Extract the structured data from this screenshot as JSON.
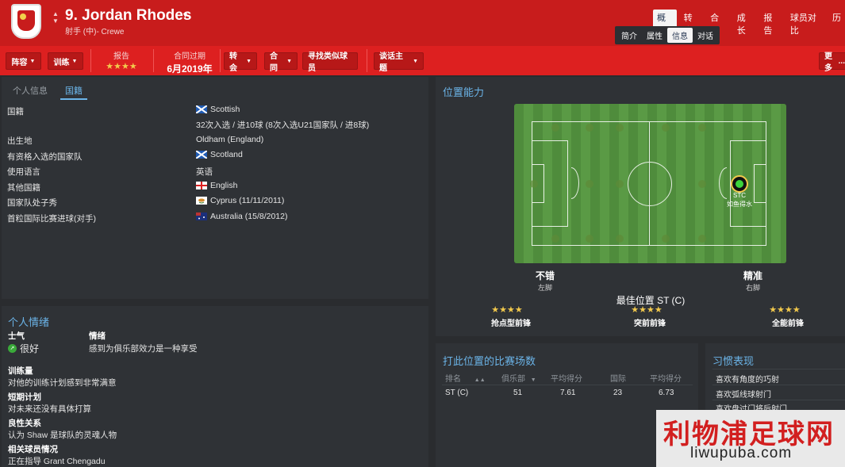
{
  "header": {
    "player_name": "9. Jordan Rhodes",
    "player_sub": "射手 (中)- Crewe",
    "nav": [
      "概况",
      "转会",
      "合同",
      "成长",
      "报告",
      "球员对比",
      "历"
    ],
    "nav_active": "概况",
    "subnav": [
      "简介",
      "属性",
      "信息",
      "对话"
    ],
    "subnav_active": "信息"
  },
  "toolbar": {
    "squad": "阵容",
    "training": "训练",
    "report_label": "报告",
    "report_stars": "★★★★",
    "contract_label": "合同过期",
    "contract_value": "6月2019年",
    "transfer": "转会",
    "contract": "合同",
    "find_similar": "寻找类似球员",
    "talk": "谈话主题",
    "more": "更多"
  },
  "tabs": [
    "个人信息",
    "国籍"
  ],
  "nationality": [
    {
      "label": "国籍",
      "value": "Scottish",
      "flag": "scotland"
    },
    {
      "label": "",
      "value": "32次入选 / 进10球 (8次入选U21国家队 / 进8球)",
      "flag": ""
    },
    {
      "label": "出生地",
      "value": "Oldham (England)",
      "flag": ""
    },
    {
      "label": "有资格入选的国家队",
      "value": "Scotland",
      "flag": "scotland"
    },
    {
      "label": "使用语言",
      "value": "英语",
      "flag": ""
    },
    {
      "label": "其他国籍",
      "value": "English",
      "flag": "england"
    },
    {
      "label": "国家队处子秀",
      "value": "Cyprus (11/11/2011)",
      "flag": "cyprus"
    },
    {
      "label": "首粒国际比赛进球(对手)",
      "value": "Australia (15/8/2012)",
      "flag": "australia"
    }
  ],
  "personal": {
    "title": "个人情绪",
    "morale_label": "士气",
    "morale_value": "很好",
    "emotion_label": "情绪",
    "emotion_value": "感到为俱乐部效力是一种享受",
    "training_label": "训练量",
    "training_value": "对他的训练计划感到非常满意",
    "shortterm_label": "短期计划",
    "shortterm_value": "对未来还没有具体打算",
    "relation_label": "良性关系",
    "relation_value": "认为 Shaw 是球队的灵魂人物",
    "related_label": "相关球员情况",
    "related_value": "正在指导 Grant Chengadu"
  },
  "positions": {
    "title": "位置能力",
    "marker_pos": "STC",
    "marker_desc": "如鱼得水",
    "left_foot_rating": "不错",
    "left_foot_label": "左脚",
    "right_foot_rating": "精准",
    "right_foot_label": "右脚",
    "best_position": "最佳位置 ST (C)",
    "roles": [
      {
        "stars": "★★★★",
        "name": "抢点型前锋"
      },
      {
        "stars": "★★★★",
        "name": "突前前锋"
      },
      {
        "stars": "★★★★",
        "name": "全能前锋"
      }
    ]
  },
  "apps": {
    "title": "打此位置的比赛场数",
    "headers": [
      "排名",
      "俱乐部",
      "平均得分",
      "国际",
      "平均得分"
    ],
    "row": [
      "ST (C)",
      "51",
      "7.61",
      "23",
      "6.73"
    ]
  },
  "habits": {
    "title": "习惯表现",
    "items": [
      "喜欢有角度的巧射",
      "喜欢弧线球射门",
      "喜欢盘过门将后射门"
    ]
  },
  "watermark": {
    "main": "利物浦足球网",
    "url": "liwupuba.com"
  },
  "colors": {
    "brand_red": "#c81c1c",
    "accent_blue": "#6bb4e8",
    "star_gold": "#f2c94c"
  }
}
